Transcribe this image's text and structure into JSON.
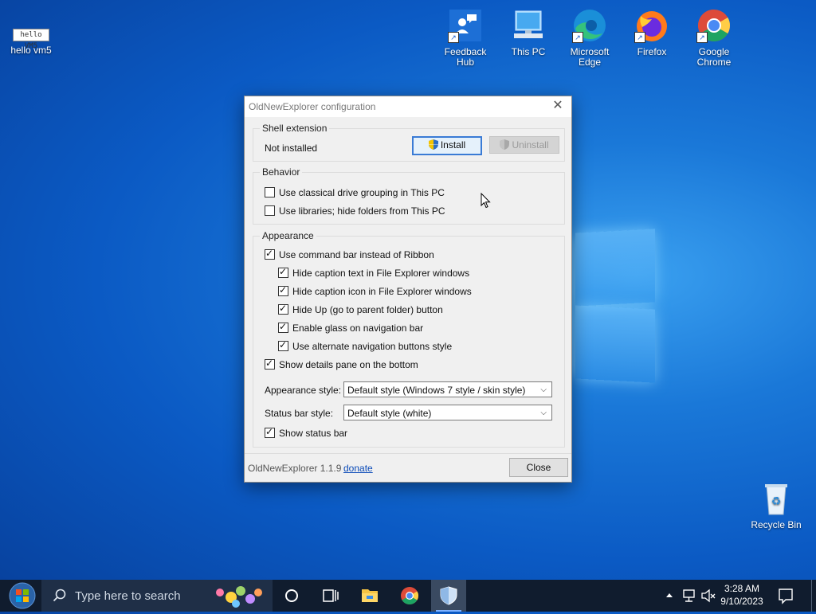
{
  "desktop": {
    "top_left_icon": {
      "label": "hello vm5",
      "badge_text": "hello VM5"
    },
    "icons": [
      {
        "label": "Feedback Hub"
      },
      {
        "label": "This PC"
      },
      {
        "label": "Microsoft Edge"
      },
      {
        "label": "Firefox"
      },
      {
        "label": "Google Chrome"
      }
    ],
    "recycle_bin": {
      "label": "Recycle Bin"
    }
  },
  "dialog": {
    "title": "OldNewExplorer configuration",
    "close_glyph": "✕",
    "shell_extension": {
      "legend": "Shell extension",
      "status": "Not installed",
      "install_label": "Install",
      "uninstall_label": "Uninstall"
    },
    "behavior": {
      "legend": "Behavior",
      "options": [
        {
          "label": "Use classical drive grouping in This PC",
          "checked": false
        },
        {
          "label": "Use libraries; hide folders from This PC",
          "checked": false
        }
      ]
    },
    "appearance": {
      "legend": "Appearance",
      "options": [
        {
          "label": "Use command bar instead of Ribbon",
          "checked": true
        },
        {
          "label": "Hide caption text in File Explorer windows",
          "checked": true
        },
        {
          "label": "Hide caption icon in File Explorer windows",
          "checked": true
        },
        {
          "label": "Hide Up (go to parent folder) button",
          "checked": true
        },
        {
          "label": "Enable glass on navigation bar",
          "checked": true
        },
        {
          "label": "Use alternate navigation buttons style",
          "checked": true
        },
        {
          "label": "Show details pane on the bottom",
          "checked": true
        }
      ],
      "appearance_style_label": "Appearance style:",
      "appearance_style_value": "Default style (Windows 7 style / skin style)",
      "status_bar_style_label": "Status bar style:",
      "status_bar_style_value": "Default style (white)",
      "show_status_bar": {
        "label": "Show status bar",
        "checked": true
      }
    },
    "footer": {
      "version": "OldNewExplorer 1.1.9",
      "donate": "donate",
      "close_label": "Close"
    }
  },
  "taskbar": {
    "search_placeholder": "Type here to search",
    "time": "3:28 AM",
    "date": "9/10/2023"
  }
}
